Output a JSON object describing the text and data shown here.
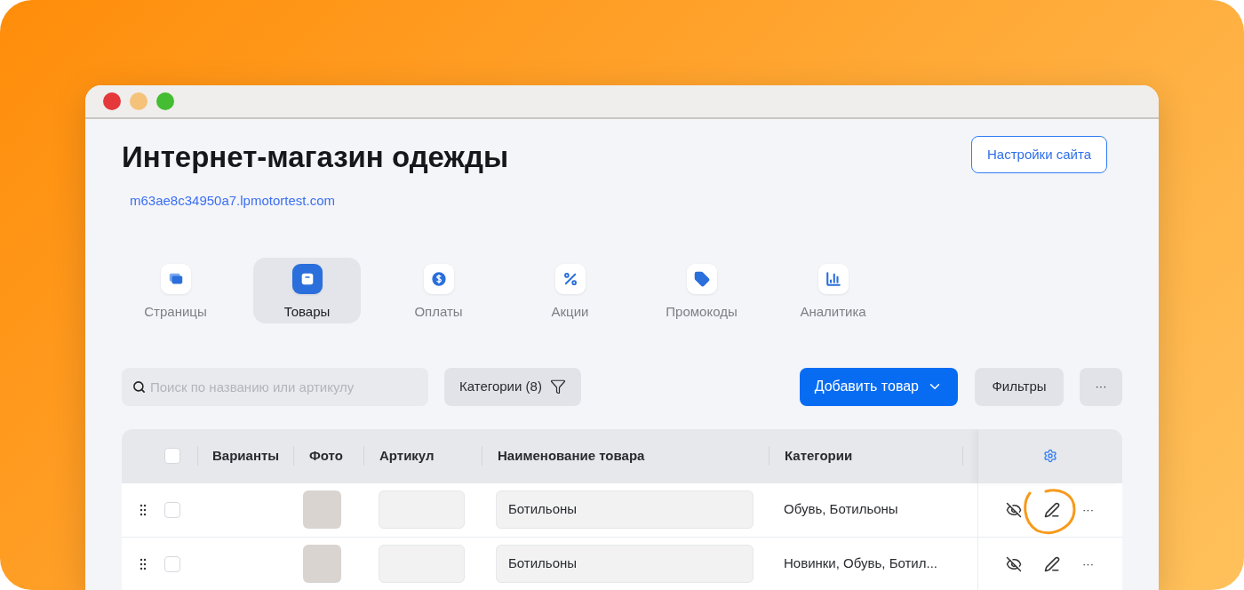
{
  "header": {
    "title": "Интернет-магазин одежды",
    "link": "m63ae8c34950a7.lpmotortest.com",
    "settings_button": "Настройки сайта"
  },
  "tabs": [
    {
      "label": "Страницы",
      "selected": false
    },
    {
      "label": "Товары",
      "selected": true
    },
    {
      "label": "Оплаты",
      "selected": false
    },
    {
      "label": "Акции",
      "selected": false
    },
    {
      "label": "Промокоды",
      "selected": false
    },
    {
      "label": "Аналитика",
      "selected": false
    }
  ],
  "toolbar": {
    "search": {
      "placeholder": "Поиск по названию или артикулу"
    },
    "categories_button": "Категории (8)",
    "add_button": "Добавить товар",
    "filters_button": "Фильтры",
    "more_button": "···"
  },
  "table": {
    "select_all": {
      "checked": false
    },
    "columns": [
      "Варианты",
      "Фото",
      "Артикул",
      "Наименование товара",
      "Категории"
    ],
    "rows": [
      {
        "checked": false,
        "name": "Ботильоны",
        "categories": "Обувь, Ботильоны",
        "highlighted": true,
        "more": "···"
      },
      {
        "checked": false,
        "name": "Ботильоны",
        "categories": "Новинки, Обувь, Ботил...",
        "highlighted": false,
        "more": "···"
      }
    ]
  }
}
